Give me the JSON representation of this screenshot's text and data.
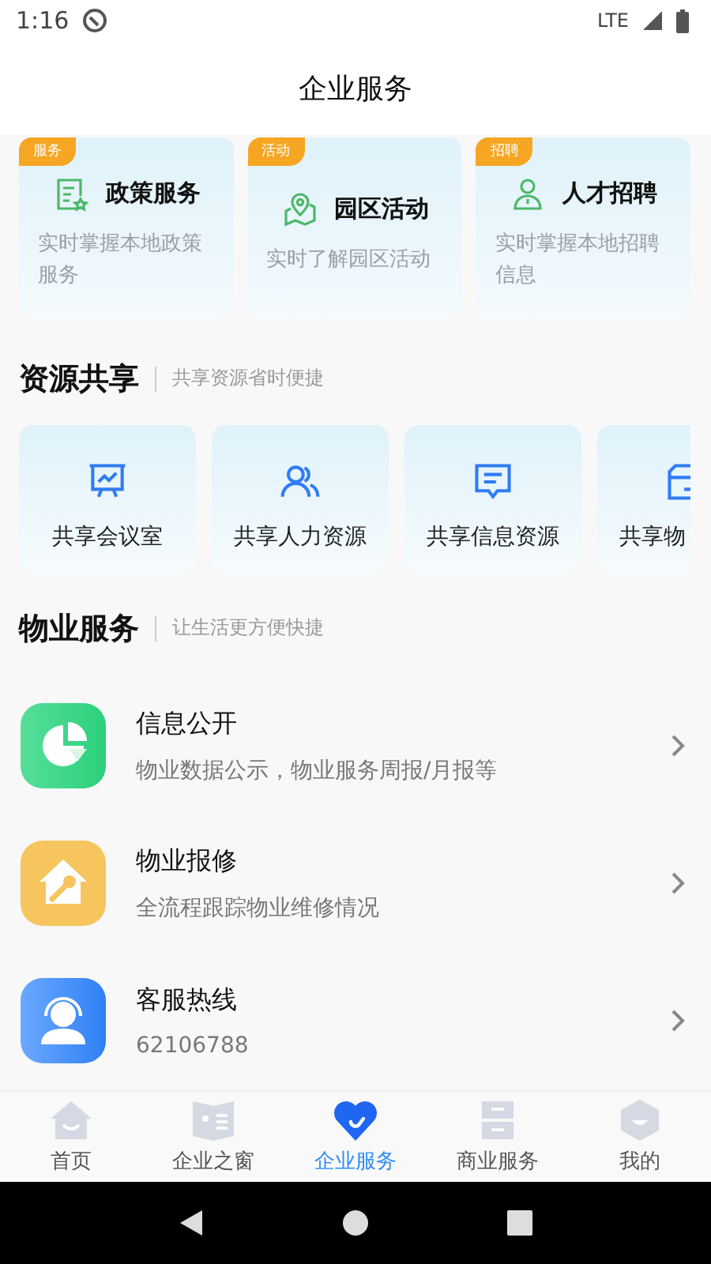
{
  "status_bar": {
    "time": "1:16",
    "network": "LTE"
  },
  "header": {
    "title": "企业服务"
  },
  "feature_cards": [
    {
      "tag": "服务",
      "title": "政策服务",
      "desc": "实时掌握本地政策服务",
      "kind": "document"
    },
    {
      "tag": "活动",
      "title": "园区活动",
      "desc": "实时了解园区活动",
      "kind": "map"
    },
    {
      "tag": "招聘",
      "title": "人才招聘",
      "desc": "实时掌握本地招聘信息",
      "kind": "person"
    }
  ],
  "resources": {
    "title": "资源共享",
    "subtitle": "共享资源省时便捷",
    "items": [
      {
        "label": "共享会议室",
        "kind": "presentation"
      },
      {
        "label": "共享人力资源",
        "kind": "people"
      },
      {
        "label": "共享信息资源",
        "kind": "message"
      },
      {
        "label": "共享物",
        "kind": "box"
      }
    ]
  },
  "property": {
    "title": "物业服务",
    "subtitle": "让生活更方便快捷",
    "items": [
      {
        "title": "信息公开",
        "desc": "物业数据公示，物业服务周报/月报等",
        "kind": "chart"
      },
      {
        "title": "物业报修",
        "desc": "全流程跟踪物业维修情况",
        "kind": "repair"
      },
      {
        "title": "客服热线",
        "desc": "62106788",
        "kind": "headset"
      }
    ]
  },
  "tabs": [
    {
      "label": "首页",
      "kind": "home",
      "selected": false
    },
    {
      "label": "企业之窗",
      "kind": "book",
      "selected": false
    },
    {
      "label": "企业服务",
      "kind": "heart",
      "selected": true
    },
    {
      "label": "商业服务",
      "kind": "cabinet",
      "selected": false
    },
    {
      "label": "我的",
      "kind": "hex",
      "selected": false
    }
  ]
}
